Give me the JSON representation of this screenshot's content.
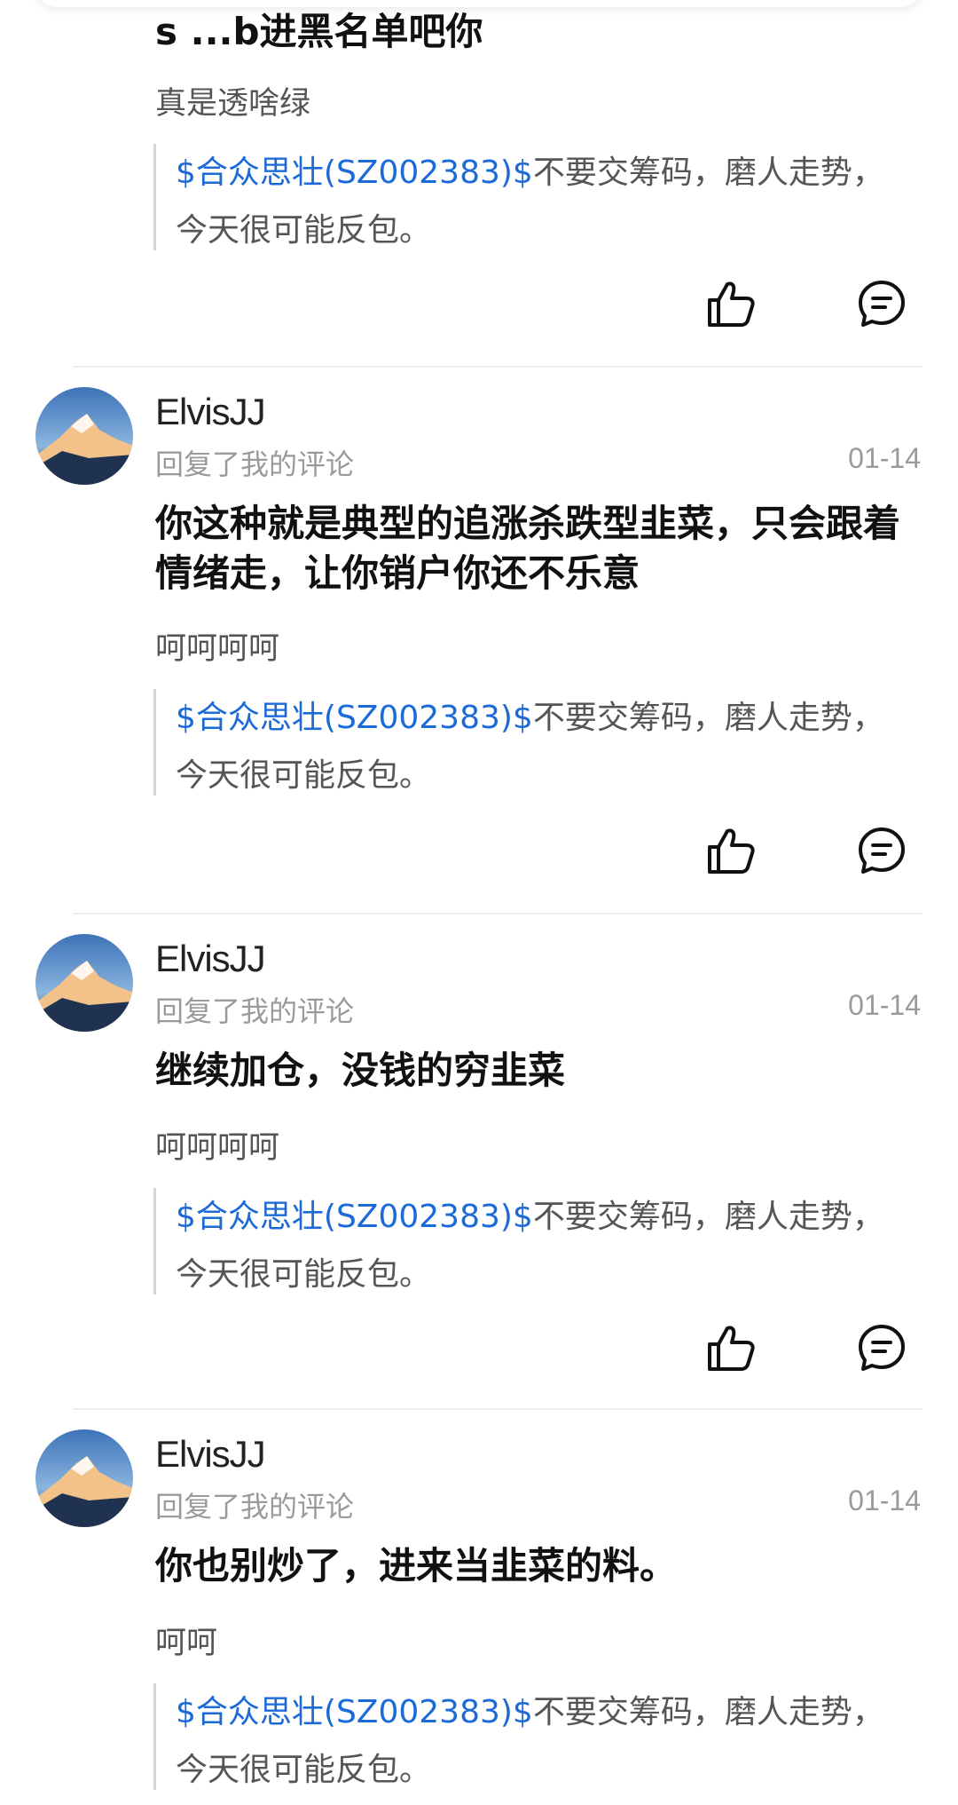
{
  "first_item": {
    "truncated_text": "s  ...b进黑名单吧你",
    "reply_text": "真是透啥绿",
    "quote": {
      "stock_link": "$合众思壮(SZ002383)$",
      "text": "不要交筹码，磨人走势，今天很可能反包。"
    }
  },
  "items": [
    {
      "username": "ElvisJJ",
      "subtitle": "回复了我的评论",
      "date": "01-14",
      "comment": "你这种就是典型的追涨杀跌型韭菜，只会跟着情绪走，让你销户你还不乐意",
      "reply_text": "呵呵呵呵",
      "quote": {
        "stock_link": "$合众思壮(SZ002383)$",
        "text": "不要交筹码，磨人走势，今天很可能反包。"
      }
    },
    {
      "username": "ElvisJJ",
      "subtitle": "回复了我的评论",
      "date": "01-14",
      "comment": "继续加仓，没钱的穷韭菜",
      "reply_text": "呵呵呵呵",
      "quote": {
        "stock_link": "$合众思壮(SZ002383)$",
        "text": "不要交筹码，磨人走势，今天很可能反包。"
      }
    },
    {
      "username": "ElvisJJ",
      "subtitle": "回复了我的评论",
      "date": "01-14",
      "comment": "你也别炒了，进来当韭菜的料。",
      "reply_text": "呵呵",
      "quote": {
        "stock_link": "$合众思壮(SZ002383)$",
        "text": "不要交筹码，磨人走势，今天很可能反包。"
      }
    }
  ],
  "icons": {
    "like": "thumbs-up-icon",
    "comment": "comment-icon"
  },
  "colors": {
    "link": "#1b6ad8",
    "muted": "#9a9a9a",
    "divider": "#eeeeee"
  }
}
